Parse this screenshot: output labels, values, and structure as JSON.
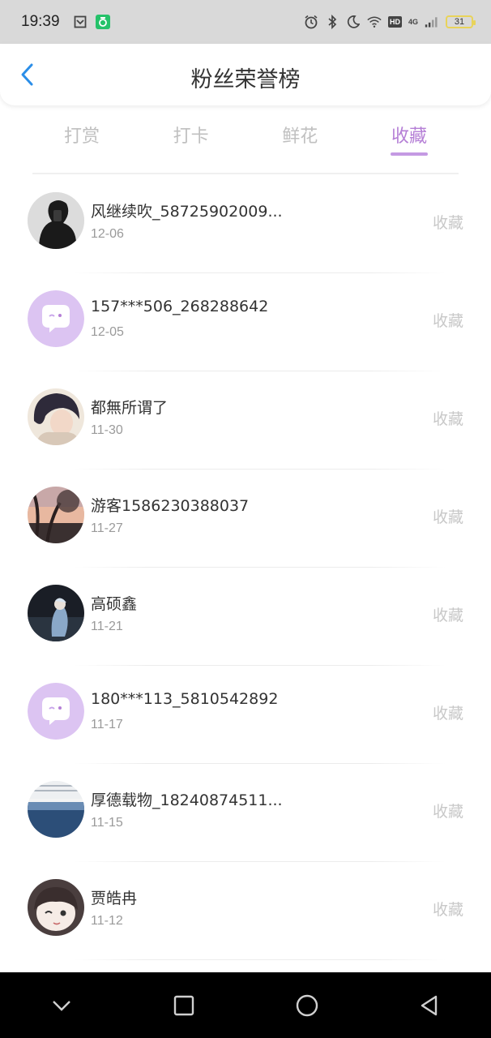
{
  "status_bar": {
    "time": "19:39",
    "hd_label": "HD",
    "network_label": "4G",
    "battery": "31"
  },
  "header": {
    "title": "粉丝荣誉榜"
  },
  "tabs": [
    {
      "label": "打赏",
      "active": false
    },
    {
      "label": "打卡",
      "active": false
    },
    {
      "label": "鲜花",
      "active": false
    },
    {
      "label": "收藏",
      "active": true
    }
  ],
  "colors": {
    "accent": "#b57fd6",
    "underline": "#c49ae3",
    "placeholder_avatar": "#dcc4f2"
  },
  "list": [
    {
      "name": "风继续吹_58725902009...",
      "date": "12-06",
      "action": "收藏",
      "avatar": "photo-dark-portrait"
    },
    {
      "name": "157***506_268288642",
      "date": "12-05",
      "action": "收藏",
      "avatar": "default-chat-bubble"
    },
    {
      "name": "都無所谓了",
      "date": "11-30",
      "action": "收藏",
      "avatar": "photo-girl-hair"
    },
    {
      "name": "游客1586230388037",
      "date": "11-27",
      "action": "收藏",
      "avatar": "photo-sunset-tree"
    },
    {
      "name": "高硕鑫",
      "date": "11-21",
      "action": "收藏",
      "avatar": "photo-anime-figure"
    },
    {
      "name": "180***113_5810542892",
      "date": "11-17",
      "action": "收藏",
      "avatar": "default-chat-bubble"
    },
    {
      "name": "厚德载物_18240874511...",
      "date": "11-15",
      "action": "收藏",
      "avatar": "photo-sea-horizon"
    },
    {
      "name": "贾皓冉",
      "date": "11-12",
      "action": "收藏",
      "avatar": "photo-cartoon-girl"
    }
  ],
  "nav_bar": {
    "icons": [
      "chevron-down-icon",
      "square-icon",
      "circle-home-icon",
      "triangle-back-icon"
    ]
  }
}
